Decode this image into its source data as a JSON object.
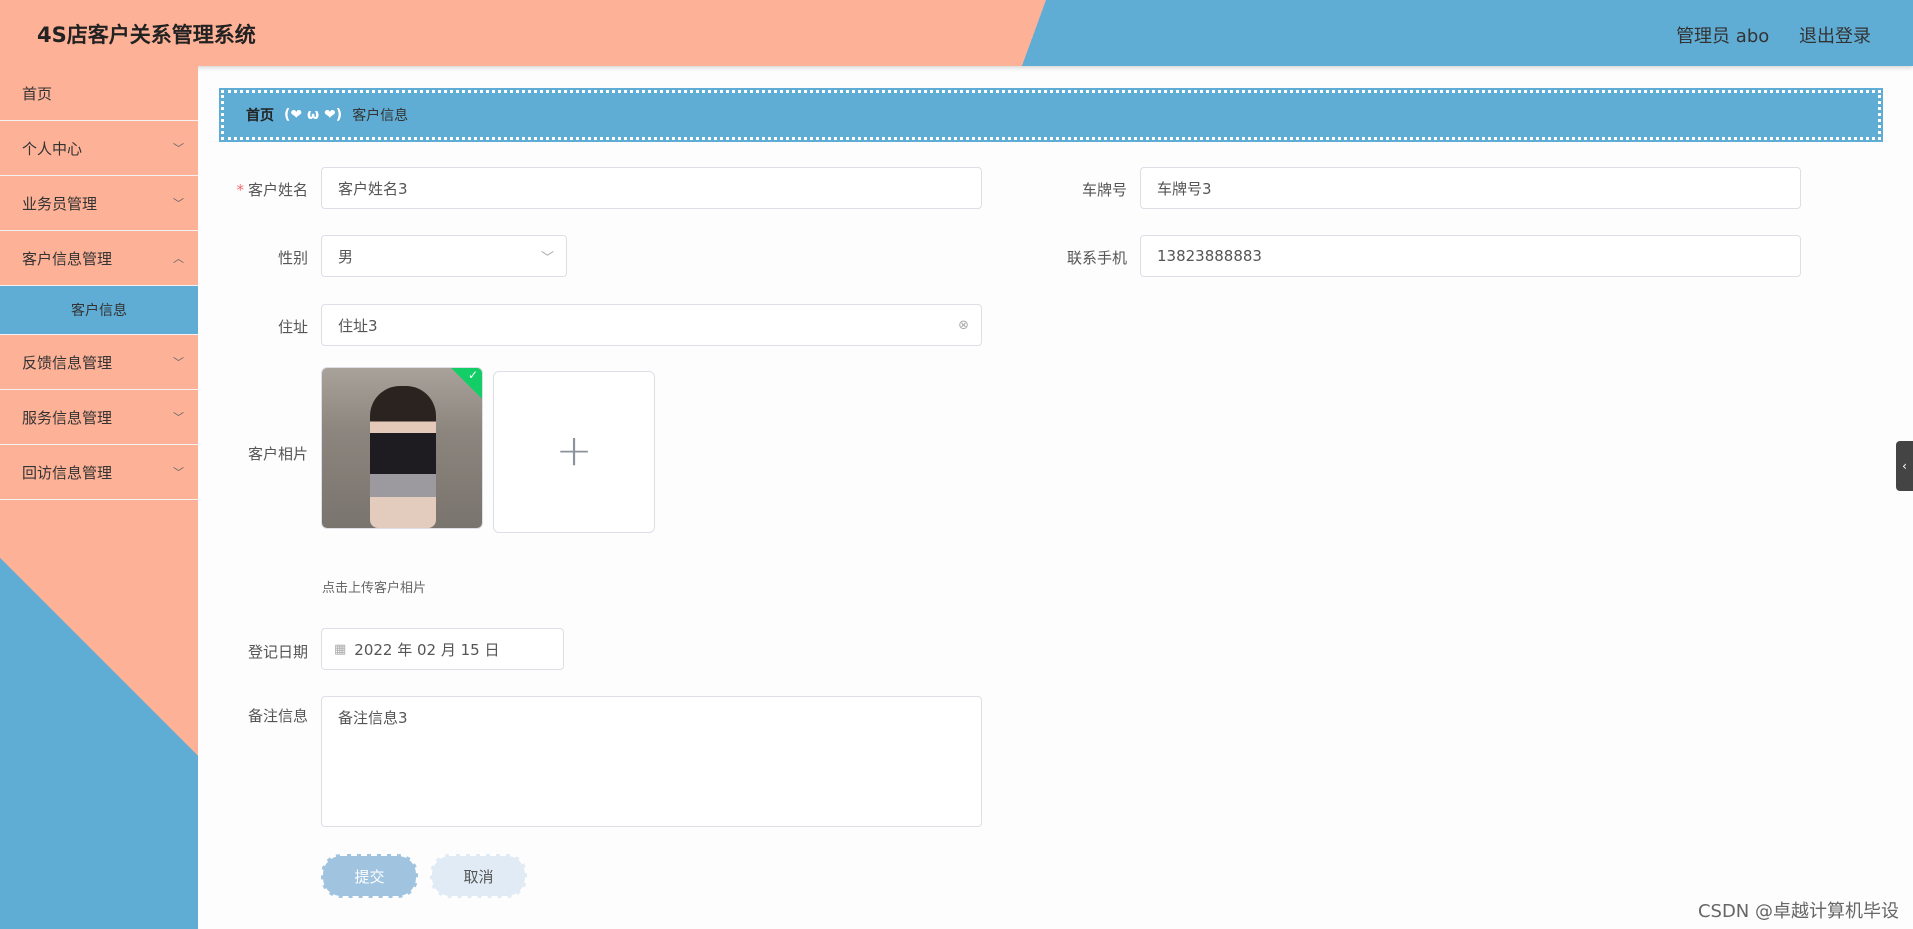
{
  "app": {
    "title": "4S店客户关系管理系统"
  },
  "header": {
    "user": "管理员 abo",
    "logout": "退出登录"
  },
  "sidebar": {
    "items": [
      {
        "label": "首页"
      },
      {
        "label": "个人中心"
      },
      {
        "label": "业务员管理"
      },
      {
        "label": "客户信息管理"
      },
      {
        "label": "客户信息"
      },
      {
        "label": "反馈信息管理"
      },
      {
        "label": "服务信息管理"
      },
      {
        "label": "回访信息管理"
      }
    ]
  },
  "breadcrumb": {
    "home": "首页",
    "separator": "(❤ ω ❤)",
    "current": "客户信息"
  },
  "form": {
    "customer_name": {
      "label": "客户姓名",
      "value": "客户姓名3"
    },
    "plate_number": {
      "label": "车牌号",
      "value": "车牌号3"
    },
    "gender": {
      "label": "性别",
      "value": "男"
    },
    "phone": {
      "label": "联系手机",
      "value": "13823888883"
    },
    "address": {
      "label": "住址",
      "value": "住址3"
    },
    "photo": {
      "label": "客户相片",
      "tip": "点击上传客户相片"
    },
    "register_date": {
      "label": "登记日期",
      "value": "2022 年 02 月 15 日"
    },
    "remarks": {
      "label": "备注信息",
      "value": "备注信息3"
    },
    "submit_label": "提交",
    "cancel_label": "取消"
  },
  "watermark": "CSDN @卓越计算机毕设",
  "colors": {
    "accent": "#5fadd4",
    "peach": "#fdb196",
    "success": "#13ce66"
  }
}
